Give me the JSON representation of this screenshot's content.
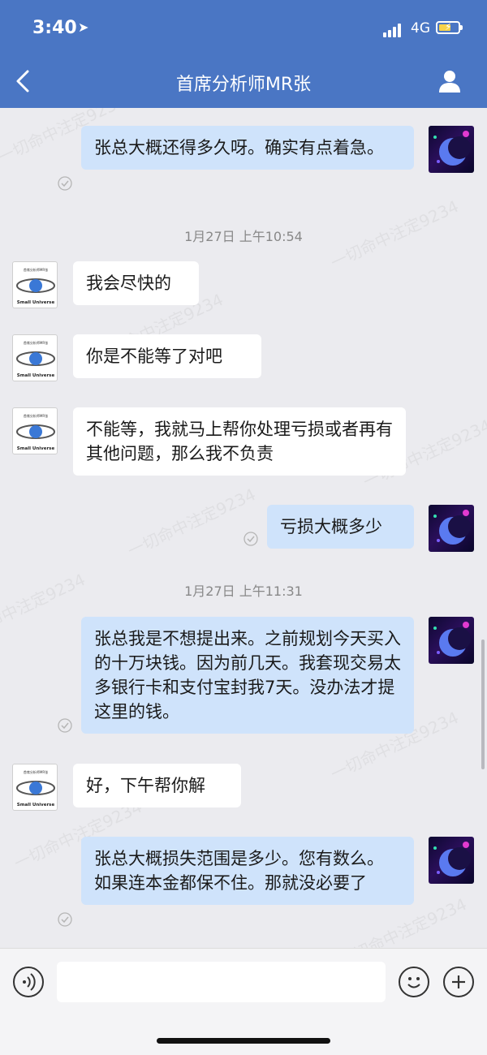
{
  "status_bar": {
    "time": "3:40",
    "network": "4G"
  },
  "header": {
    "title": "首席分析师MR张"
  },
  "avatar_left_text": {
    "top": "首席分析师MR张",
    "bottom": "Small Universe"
  },
  "watermark_text": "一切命中注定9234",
  "messages": [
    {
      "side": "right",
      "text": "张总大概还得多久呀。确实有点着急。"
    },
    {
      "side": "timestamp",
      "text": "1月27日 上午10:54"
    },
    {
      "side": "left",
      "text": "我会尽快的"
    },
    {
      "side": "left",
      "text": "你是不能等了对吧"
    },
    {
      "side": "left",
      "text": "不能等，我就马上帮你处理亏损或者再有其他问题，那么我不负责"
    },
    {
      "side": "right",
      "text": "亏损大概多少"
    },
    {
      "side": "timestamp",
      "text": "1月27日 上午11:31"
    },
    {
      "side": "right",
      "text": "张总我是不想提出来。之前规划今天买入的十万块钱。因为前几天。我套现交易太多银行卡和支付宝封我7天。没办法才提这里的钱。"
    },
    {
      "side": "left",
      "text": "好，下午帮你解"
    },
    {
      "side": "right",
      "text": "张总大概损失范围是多少。您有数么。 如果连本金都保不住。那就没必要了"
    }
  ],
  "input": {
    "placeholder": ""
  },
  "colors": {
    "header": "#4a76c4",
    "bubble_right": "#cfe3fb",
    "bubble_left": "#ffffff",
    "background": "#ebebef"
  }
}
